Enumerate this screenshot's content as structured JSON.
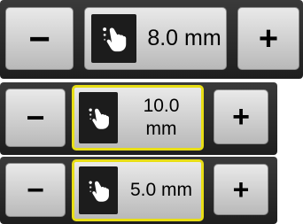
{
  "controls": [
    {
      "minus_label": "−",
      "value_label": "8.0 mm",
      "plus_label": "+",
      "icon": "hand-tap-icon",
      "focused": false
    },
    {
      "minus_label": "−",
      "value_label": "10.0 mm",
      "plus_label": "+",
      "icon": "hand-tap-icon",
      "focused": true
    },
    {
      "minus_label": "−",
      "value_label": "5.0 mm",
      "plus_label": "+",
      "icon": "hand-tap-icon",
      "focused": true
    }
  ],
  "colors": {
    "panel": "#2b2b2b",
    "button": "#d4d4d4",
    "focus_outline": "#e8de16",
    "icon_background": "#1c1c1c"
  }
}
